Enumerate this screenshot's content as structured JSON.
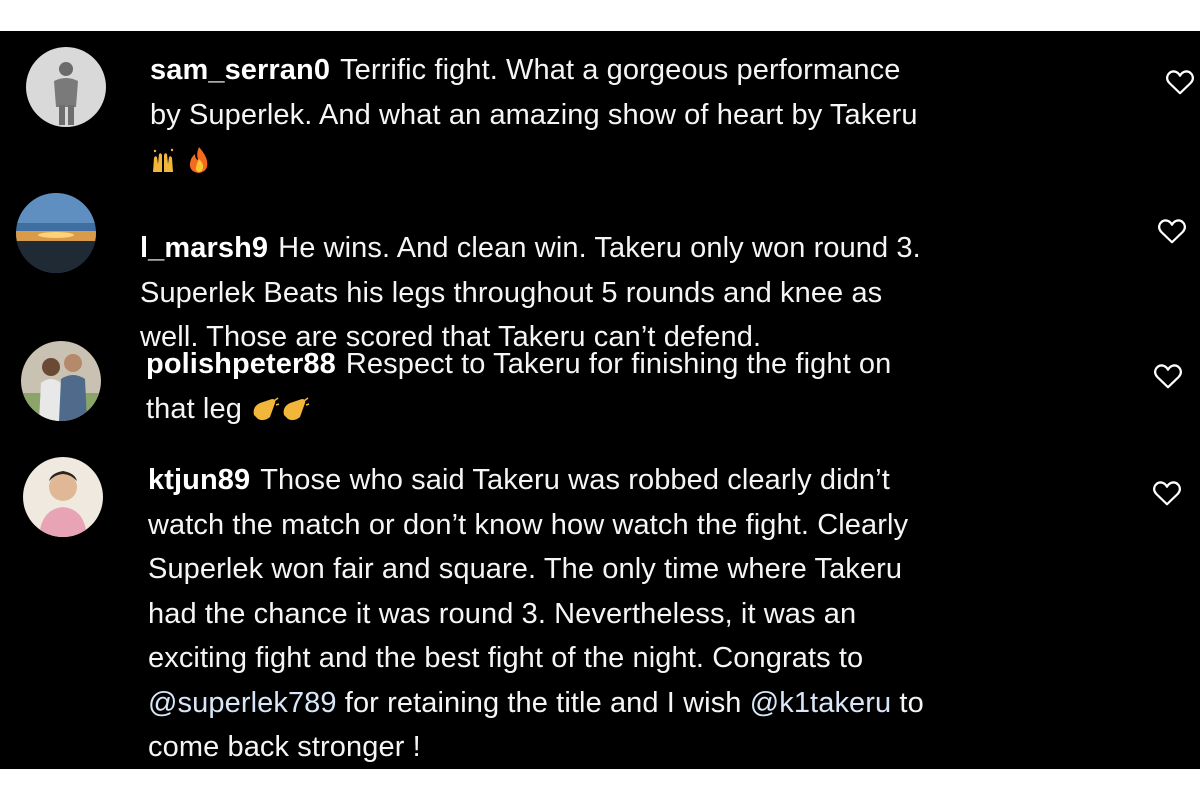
{
  "comments": [
    {
      "username": "sam_serran0",
      "lines": [
        "Terrific fight. What a gorgeous performance",
        "by Superlek. And what an amazing show of heart by Takeru"
      ],
      "emojis": [
        "raising-hands",
        "fire"
      ],
      "like_icon": "heart-outline-icon"
    },
    {
      "username": "l_marsh9",
      "lines": [
        "He wins. And clean win. Takeru only won round 3.",
        "Superlek Beats his legs throughout 5 rounds and knee as",
        "well. Those are scored that Takeru can’t defend."
      ],
      "like_icon": "heart-outline-icon"
    },
    {
      "username": "polishpeter88",
      "lines": [
        "Respect to Takeru for finishing the fight on",
        "that leg"
      ],
      "emojis": [
        "clapping-hands",
        "clapping-hands"
      ],
      "like_icon": "heart-outline-icon"
    },
    {
      "username": "ktjun89",
      "lines": [
        "Those who said Takeru was robbed clearly didn’t",
        "watch the match or don’t know how watch the fight. Clearly",
        "Superlek won fair and square. The only time where Takeru",
        "had the chance it was round 3. Nevertheless, it was an",
        "exciting fight and the best fight of the night. Congrats to"
      ],
      "mention_line": {
        "mention1": "@superlek789",
        "middle": " for retaining the title and I wish ",
        "mention2": "@k1takeru",
        "end": " to"
      },
      "last_line": "come back stronger !",
      "like_icon": "heart-outline-icon"
    }
  ]
}
